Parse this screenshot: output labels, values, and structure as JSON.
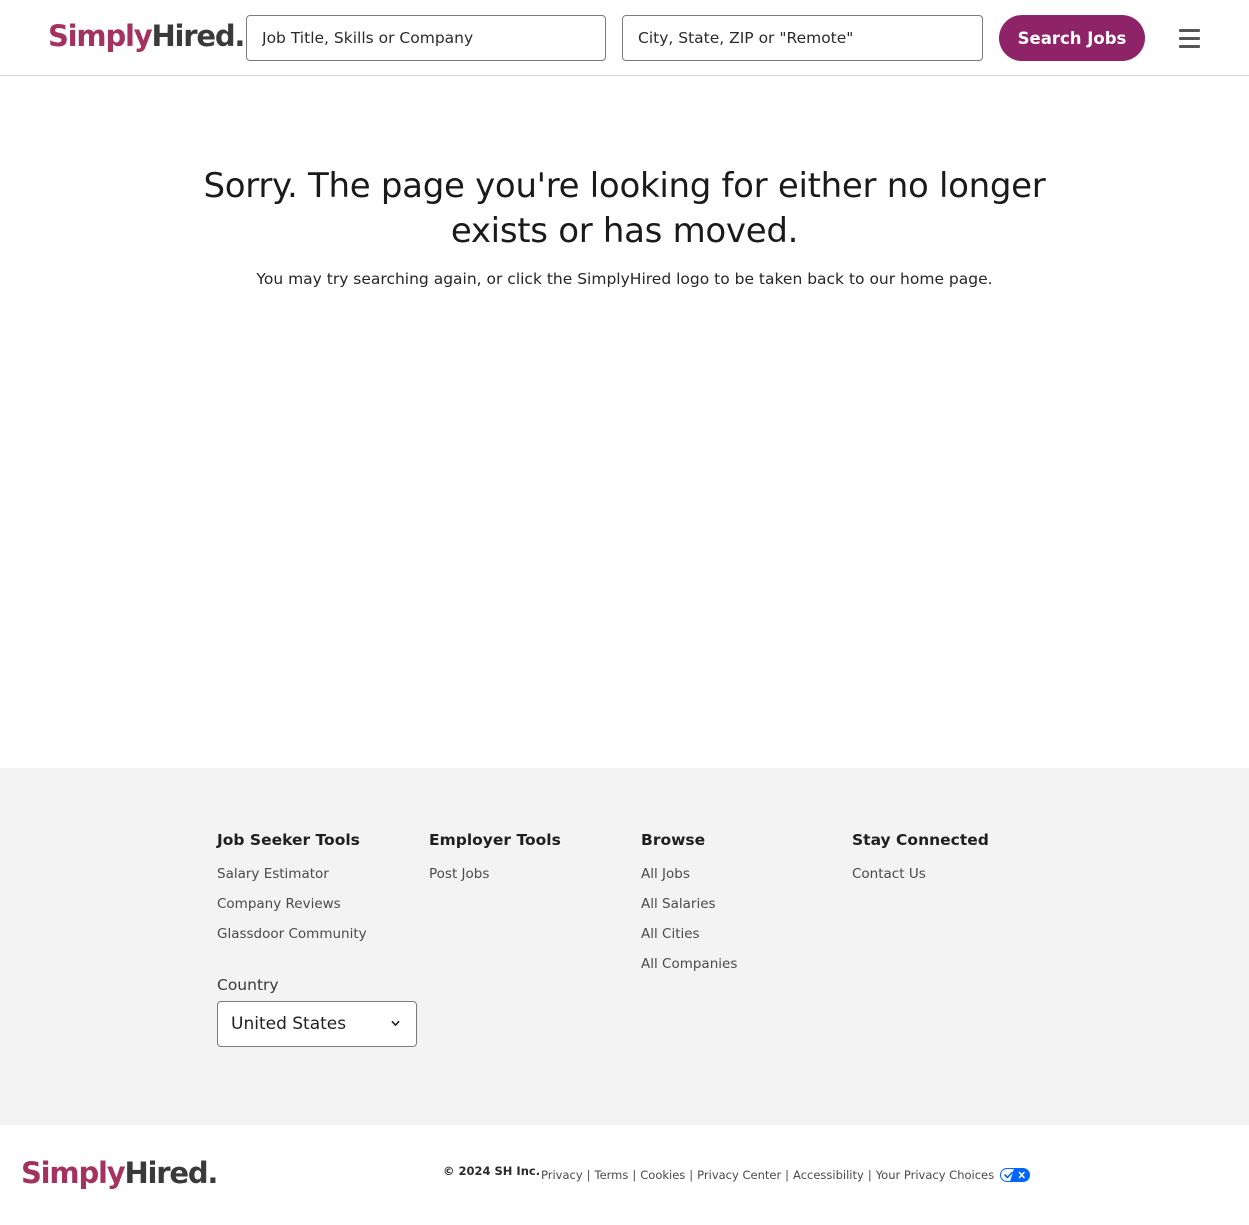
{
  "header": {
    "logo": {
      "part1": "Simply",
      "part2": "Hired",
      "dot": "."
    },
    "what_placeholder": "Job Title, Skills or Company",
    "where_placeholder": "City, State, ZIP or \"Remote\"",
    "search_label": "Search Jobs",
    "menu_icon": "hamburger-menu-icon"
  },
  "main": {
    "title": "Sorry. The page you're looking for either no longer exists or has moved.",
    "subtitle": "You may try searching again, or click the SimplyHired logo to be taken back to our home page."
  },
  "footer": {
    "columns": [
      {
        "heading": "Job Seeker Tools",
        "links": [
          "Salary Estimator",
          "Company Reviews",
          "Glassdoor Community"
        ]
      },
      {
        "heading": "Employer Tools",
        "links": [
          "Post Jobs"
        ]
      },
      {
        "heading": "Browse",
        "links": [
          "All Jobs",
          "All Salaries",
          "All Cities",
          "All Companies"
        ]
      },
      {
        "heading": "Stay Connected",
        "links": [
          "Contact Us"
        ]
      }
    ],
    "country_label": "Country",
    "country_value": "United States"
  },
  "bottom": {
    "logo": {
      "part1": "Simply",
      "part2": "Hired",
      "dot": "."
    },
    "copyright": "© 2024 SH Inc.",
    "legal_links": [
      "Privacy",
      "Terms",
      "Cookies",
      "Privacy Center",
      "Accessibility",
      "Your Privacy Choices"
    ],
    "separator": "|"
  },
  "colors": {
    "brand_primary": "#8e2467",
    "logo_pink": "#a3325f",
    "logo_dark": "#3a3a3a",
    "footer_bg": "#f3f3f3",
    "privacy_toggle_blue": "#0066ff"
  }
}
